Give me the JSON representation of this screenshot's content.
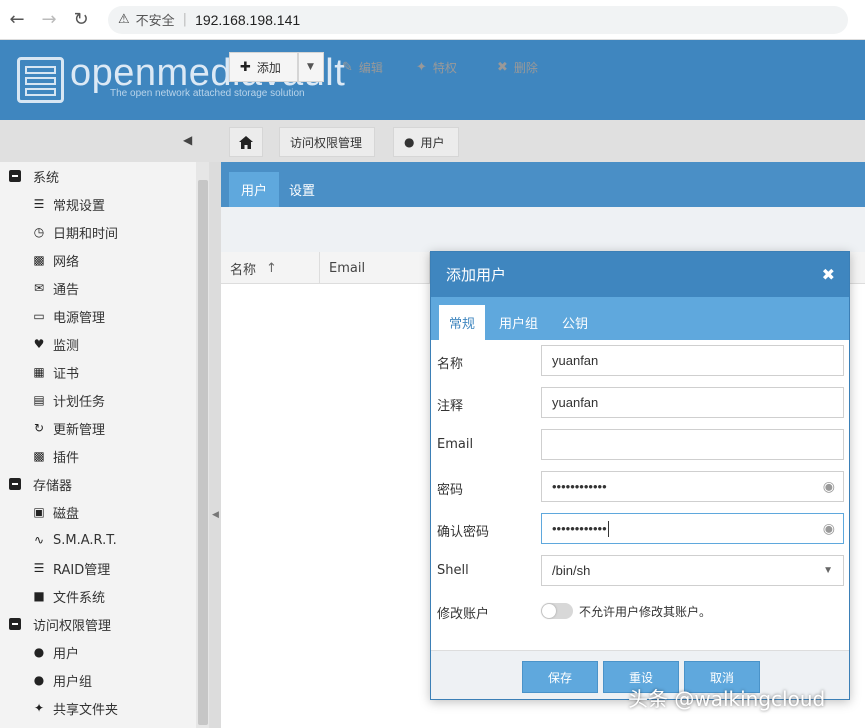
{
  "browser": {
    "insecure_label": "不安全",
    "url": "192.168.198.141"
  },
  "header": {
    "logo_text": "openmediavault",
    "logo_subtitle": "The open network attached storage solution"
  },
  "breadcrumb": {
    "items": [
      "访问权限管理",
      "用户"
    ]
  },
  "sidebar": {
    "groups": [
      {
        "label": "系统",
        "items": [
          "常规设置",
          "日期和时间",
          "网络",
          "通告",
          "电源管理",
          "监测",
          "证书",
          "计划任务",
          "更新管理",
          "插件"
        ]
      },
      {
        "label": "存储器",
        "items": [
          "磁盘",
          "S.M.A.R.T.",
          "RAID管理",
          "文件系统"
        ]
      },
      {
        "label": "访问权限管理",
        "items": [
          "用户",
          "用户组",
          "共享文件夹"
        ]
      }
    ]
  },
  "main": {
    "tabs": [
      "用户",
      "设置"
    ],
    "toolbar": {
      "add": "添加",
      "edit": "编辑",
      "privileges": "特权",
      "delete": "删除"
    },
    "columns": [
      "名称",
      "Email"
    ]
  },
  "dialog": {
    "title": "添加用户",
    "tabs": [
      "常规",
      "用户组",
      "公钥"
    ],
    "fields": {
      "name_label": "名称",
      "name_value": "yuanfan",
      "comment_label": "注释",
      "comment_value": "yuanfan",
      "email_label": "Email",
      "email_value": "",
      "password_label": "密码",
      "password_value": "••••••••••••",
      "confirm_label": "确认密码",
      "confirm_value": "••••••••••••",
      "shell_label": "Shell",
      "shell_value": "/bin/sh",
      "modify_label": "修改账户",
      "modify_toggle_text": "不允许用户修改其账户。"
    },
    "buttons": {
      "save": "保存",
      "reset": "重设",
      "cancel": "取消"
    }
  },
  "watermark": "头条 @walkingcloud"
}
